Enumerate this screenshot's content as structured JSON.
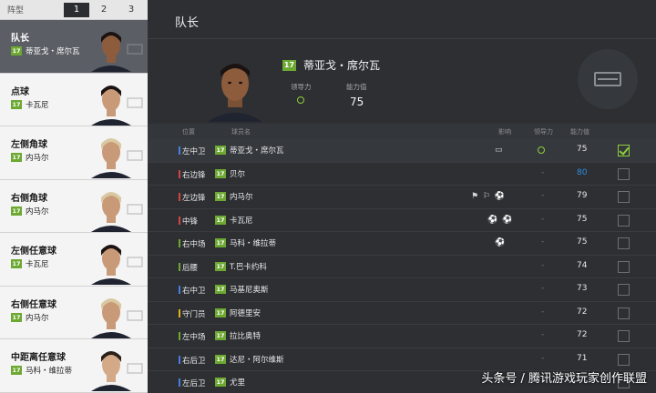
{
  "formation": {
    "label": "阵型",
    "tabs": [
      "1",
      "2",
      "3"
    ],
    "active_tab": "1"
  },
  "slots": [
    {
      "title": "队长",
      "player": "蒂亚戈・席尔瓦",
      "rating_badge": "17",
      "active": true
    },
    {
      "title": "点球",
      "player": "卡瓦尼",
      "rating_badge": "17"
    },
    {
      "title": "左侧角球",
      "player": "内马尔",
      "rating_badge": "17"
    },
    {
      "title": "右侧角球",
      "player": "内马尔",
      "rating_badge": "17"
    },
    {
      "title": "左侧任意球",
      "player": "卡瓦尼",
      "rating_badge": "17"
    },
    {
      "title": "右侧任意球",
      "player": "内马尔",
      "rating_badge": "17"
    },
    {
      "title": "中距离任意球",
      "player": "马科・维拉蒂",
      "rating_badge": "17"
    }
  ],
  "detail": {
    "title": "队长",
    "captain_name": "蒂亚戈・席尔瓦",
    "captain_badge": "17",
    "leadership_label": "领导力",
    "ability_label": "能力值",
    "ability_value": "75"
  },
  "table": {
    "headers": {
      "pos": "位置",
      "name": "球员名",
      "skill": "影响",
      "lead": "领导力",
      "ability": "能力值"
    },
    "rows": [
      {
        "pos": "左中卫",
        "pos_color": "#4a7de0",
        "name": "蒂亚戈・席尔瓦",
        "badge": "17",
        "skills": "▭",
        "leadership": "ring",
        "ability": "75",
        "checked": true
      },
      {
        "pos": "右边锋",
        "pos_color": "#d04545",
        "name": "贝尔",
        "badge": "17",
        "skills": "",
        "leadership": "-",
        "ability": "80",
        "ability_color": "#2f8fe0",
        "checked": false
      },
      {
        "pos": "左边锋",
        "pos_color": "#d04545",
        "name": "内马尔",
        "badge": "17",
        "skills": "⚑ ⚐ ⚽",
        "leadership": "-",
        "ability": "79",
        "checked": false
      },
      {
        "pos": "中锋",
        "pos_color": "#d04545",
        "name": "卡瓦尼",
        "badge": "17",
        "skills": "⚽ ⚽",
        "leadership": "-",
        "ability": "75",
        "checked": false
      },
      {
        "pos": "右中场",
        "pos_color": "#6ca832",
        "name": "马科・维拉蒂",
        "badge": "17",
        "skills": "⚽",
        "leadership": "-",
        "ability": "75",
        "checked": false
      },
      {
        "pos": "后腰",
        "pos_color": "#6ca832",
        "name": "T.巴卡约科",
        "badge": "17",
        "skills": "",
        "leadership": "-",
        "ability": "74",
        "checked": false
      },
      {
        "pos": "右中卫",
        "pos_color": "#4a7de0",
        "name": "马基尼奥斯",
        "badge": "17",
        "skills": "",
        "leadership": "-",
        "ability": "73",
        "checked": false
      },
      {
        "pos": "守门员",
        "pos_color": "#e0b020",
        "name": "阿德里安",
        "badge": "17",
        "skills": "",
        "leadership": "-",
        "ability": "72",
        "checked": false
      },
      {
        "pos": "左中场",
        "pos_color": "#6ca832",
        "name": "拉比奥特",
        "badge": "17",
        "skills": "",
        "leadership": "-",
        "ability": "72",
        "checked": false
      },
      {
        "pos": "右后卫",
        "pos_color": "#4a7de0",
        "name": "达尼・阿尔维斯",
        "badge": "17",
        "skills": "",
        "leadership": "-",
        "ability": "71",
        "checked": false
      },
      {
        "pos": "左后卫",
        "pos_color": "#4a7de0",
        "name": "尤里",
        "badge": "17",
        "skills": "",
        "leadership": "-",
        "ability": "",
        "checked": false
      }
    ]
  },
  "watermark": "头条号 / 腾讯游戏玩家创作联盟",
  "colors": {
    "accent": "#8fcf3a",
    "badge": "#6ca832",
    "panel": "#2d2f33"
  }
}
